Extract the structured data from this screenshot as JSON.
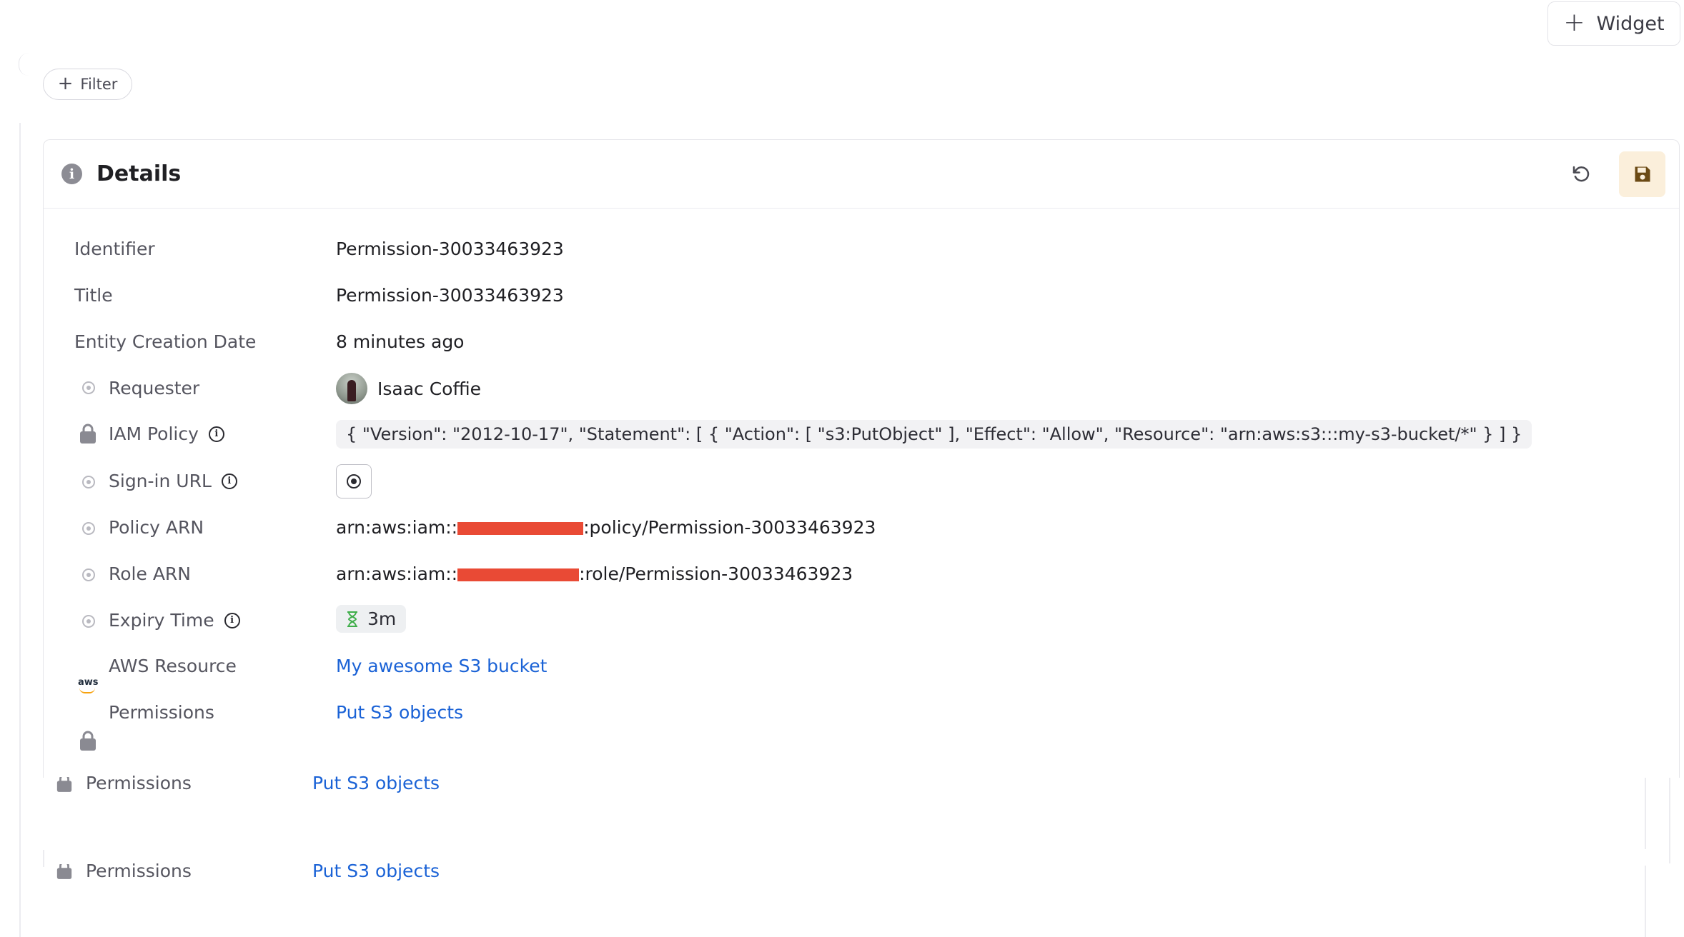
{
  "toolbar": {
    "widget_label": "Widget",
    "filter_label": "Filter"
  },
  "card": {
    "title": "Details",
    "rows": {
      "identifier": {
        "label": "Identifier",
        "value": "Permission-30033463923"
      },
      "title": {
        "label": "Title",
        "value": "Permission-30033463923"
      },
      "created": {
        "label": "Entity Creation Date",
        "value": "8 minutes ago"
      },
      "requester": {
        "label": "Requester",
        "value": "Isaac Coffie"
      },
      "iam_policy": {
        "label": "IAM Policy",
        "value": "{ \"Version\": \"2012-10-17\", \"Statement\": [ { \"Action\": [ \"s3:PutObject\" ], \"Effect\": \"Allow\", \"Resource\": \"arn:aws:s3:::my-s3-bucket/*\" } ] }"
      },
      "signin": {
        "label": "Sign-in URL"
      },
      "policy_arn": {
        "label": "Policy ARN",
        "prefix": "arn:aws:iam::",
        "suffix": ":policy/Permission-30033463923"
      },
      "role_arn": {
        "label": "Role ARN",
        "prefix": "arn:aws:iam::",
        "suffix": ":role/Permission-30033463923"
      },
      "expiry": {
        "label": "Expiry Time",
        "value": "3m"
      },
      "aws_resource": {
        "label": "AWS Resource",
        "value": "My awesome S3 bucket"
      },
      "permissions": {
        "label": "Permissions",
        "value": "Put S3 objects"
      }
    }
  },
  "ghost_rows": [
    {
      "label": "Permissions",
      "value": "Put S3 objects"
    },
    {
      "label": "Permissions",
      "value": "Put S3 objects"
    }
  ],
  "colors": {
    "link": "#1a62d6",
    "save_bg": "#fbefdb",
    "save_icon": "#6b4a14",
    "redaction": "#e94a35",
    "hourglass": "#3fae4a"
  }
}
